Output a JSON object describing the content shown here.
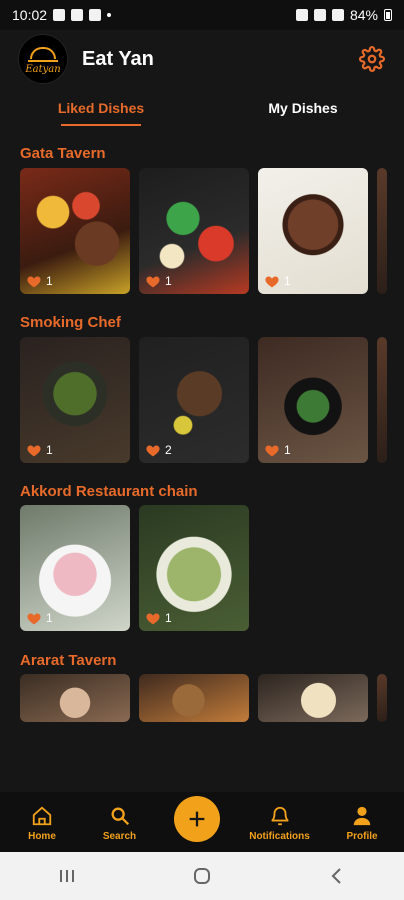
{
  "status_bar": {
    "time": "10:02",
    "battery": "84%"
  },
  "header": {
    "logo_text": "Eatyan",
    "title": "Eat Yan"
  },
  "tabs": [
    {
      "label": "Liked Dishes",
      "active": true
    },
    {
      "label": "My Dishes",
      "active": false
    }
  ],
  "sections": [
    {
      "title": "Gata Tavern",
      "cards": [
        {
          "likes": "1"
        },
        {
          "likes": "1"
        },
        {
          "likes": "1"
        }
      ]
    },
    {
      "title": "Smoking Chef",
      "cards": [
        {
          "likes": "1"
        },
        {
          "likes": "2"
        },
        {
          "likes": "1"
        }
      ]
    },
    {
      "title": "Akkord Restaurant chain",
      "cards": [
        {
          "likes": "1"
        },
        {
          "likes": "1"
        }
      ]
    },
    {
      "title": "Ararat Tavern",
      "cards": [
        {
          "likes": ""
        },
        {
          "likes": ""
        },
        {
          "likes": ""
        }
      ]
    }
  ],
  "bottom_nav": {
    "home": "Home",
    "search": "Search",
    "add": "+",
    "notifications": "Notifications",
    "profile": "Profile"
  },
  "colors": {
    "accent": "#f2a11a",
    "section_title": "#e76a2a",
    "background": "#161616"
  }
}
